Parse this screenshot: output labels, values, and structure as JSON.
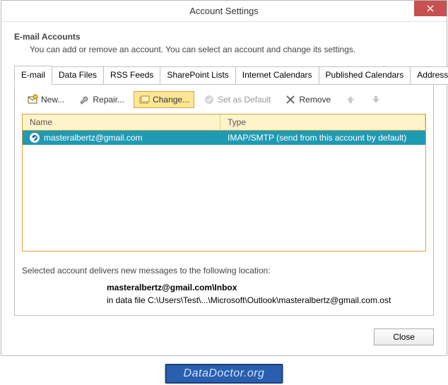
{
  "dialog": {
    "title": "Account Settings",
    "heading": "E-mail Accounts",
    "subheading": "You can add or remove an account. You can select an account and change its settings."
  },
  "tabs": [
    {
      "label": "E-mail",
      "active": true
    },
    {
      "label": "Data Files"
    },
    {
      "label": "RSS Feeds"
    },
    {
      "label": "SharePoint Lists"
    },
    {
      "label": "Internet Calendars"
    },
    {
      "label": "Published Calendars"
    },
    {
      "label": "Address Books"
    }
  ],
  "toolbar": {
    "new": "New...",
    "repair": "Repair...",
    "change": "Change...",
    "set_default": "Set as Default",
    "remove": "Remove"
  },
  "list": {
    "col_name": "Name",
    "col_type": "Type",
    "rows": [
      {
        "name": "masteralbertz@gmail.com",
        "type": "IMAP/SMTP (send from this account by default)"
      }
    ]
  },
  "footer": {
    "note": "Selected account delivers new messages to the following location:",
    "location": "masteralbertz@gmail.com\\Inbox",
    "path": "in data file C:\\Users\\Test\\...\\Microsoft\\Outlook\\masteralbertz@gmail.com.ost",
    "close": "Close"
  },
  "watermark": "DataDoctor.org"
}
